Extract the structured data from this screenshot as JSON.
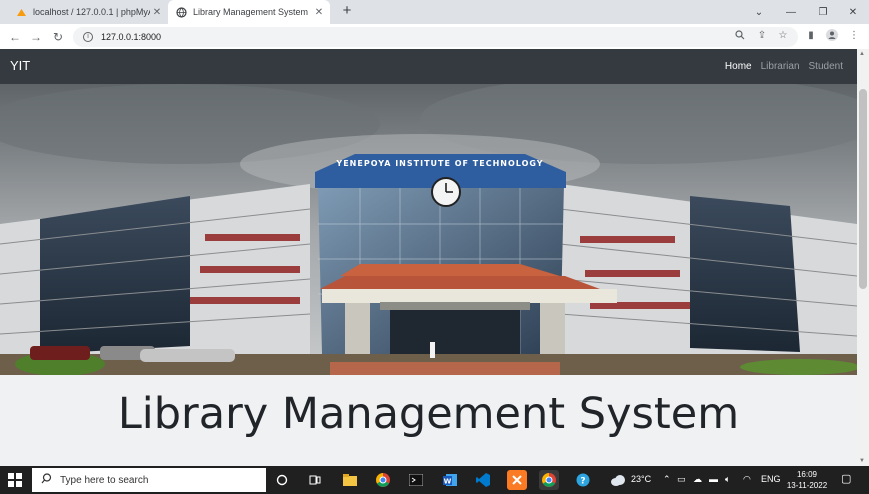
{
  "browser": {
    "tabs": [
      {
        "title": "localhost / 127.0.0.1 | phpMyAdm",
        "active": false
      },
      {
        "title": "Library Management System",
        "active": true
      }
    ],
    "url": "127.0.0.1:8000"
  },
  "site": {
    "brand": "YIT",
    "nav": [
      {
        "label": "Home",
        "active": true
      },
      {
        "label": "Librarian",
        "active": false
      },
      {
        "label": "Student",
        "active": false
      }
    ],
    "hero_sign": "YENEPOYA   INSTITUTE OF   TECHNOLOGY",
    "heading": "Library Management System"
  },
  "taskbar": {
    "search_placeholder": "Type here to search",
    "weather": "23°C",
    "language": "ENG",
    "time": "16:09",
    "date": "13-11-2022"
  },
  "colors": {
    "navbar": "#343a40",
    "page_bg": "#f0f1f3",
    "taskbar": "#202020"
  }
}
